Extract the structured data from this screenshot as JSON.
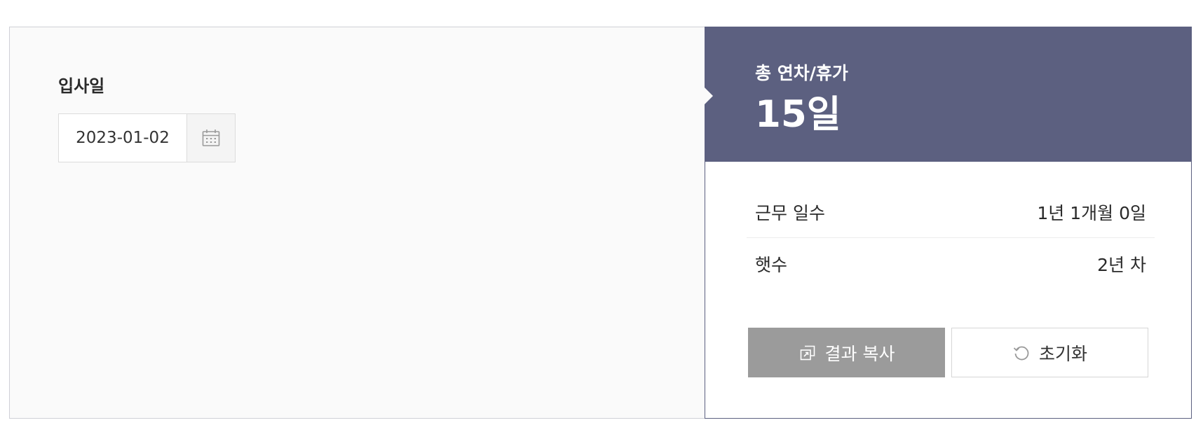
{
  "input": {
    "label": "입사일",
    "date_value": "2023-01-02"
  },
  "result": {
    "title": "총 연차/휴가",
    "total": "15일",
    "rows": [
      {
        "label": "근무 일수",
        "value": "1년 1개월 0일"
      },
      {
        "label": "햇수",
        "value": "2년 차"
      }
    ]
  },
  "actions": {
    "copy_label": "결과 복사",
    "reset_label": "초기화"
  },
  "icons": {
    "calendar": "calendar-icon",
    "copy": "copy-icon",
    "reset": "reset-icon"
  },
  "colors": {
    "header_bg": "#5c6080",
    "copy_button_bg": "#9b9b9b",
    "panel_bg": "#fafafa"
  }
}
